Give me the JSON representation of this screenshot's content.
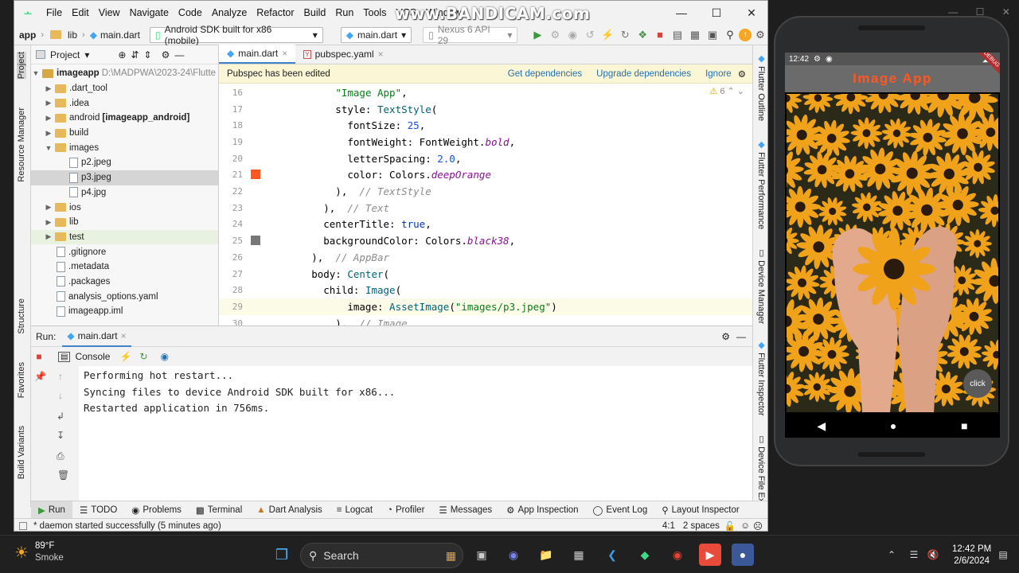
{
  "watermark": "www.BANDICAM.com",
  "menu": [
    "File",
    "Edit",
    "View",
    "Navigate",
    "Code",
    "Analyze",
    "Refactor",
    "Build",
    "Run",
    "Tools",
    "VCS",
    "Window"
  ],
  "nav": {
    "crumbs": [
      "app",
      "lib",
      "main.dart"
    ],
    "device_combo": "Android SDK built for x86 (mobile)",
    "file_combo": "main.dart",
    "emulator_combo": "Nexus 6 API 29"
  },
  "left_strip": [
    "Project",
    "Resource Manager",
    "Structure",
    "Favorites",
    "Build Variants"
  ],
  "right_strip": [
    "Flutter Outline",
    "Flutter Performance",
    "Device Manager",
    "Flutter Inspector",
    "Device File Ex"
  ],
  "project": {
    "header": "Project",
    "root_name": "imageapp",
    "root_path": "D:\\MADPWA\\2023-24\\Flutte",
    "items": [
      {
        "label": ".dart_tool",
        "type": "folder",
        "indent": 1
      },
      {
        "label": ".idea",
        "type": "folder",
        "indent": 1
      },
      {
        "label": "android",
        "bold_suffix": "[imageapp_android]",
        "type": "folder",
        "indent": 1
      },
      {
        "label": "build",
        "type": "folder",
        "indent": 1
      },
      {
        "label": "images",
        "type": "folder",
        "indent": 1,
        "open": true
      },
      {
        "label": "p2.jpeg",
        "type": "file",
        "indent": 2
      },
      {
        "label": "p3.jpeg",
        "type": "file",
        "indent": 2,
        "selected": true
      },
      {
        "label": "p4.jpg",
        "type": "file",
        "indent": 2
      },
      {
        "label": "ios",
        "type": "folder",
        "indent": 1
      },
      {
        "label": "lib",
        "type": "folder",
        "indent": 1
      },
      {
        "label": "test",
        "type": "folder",
        "indent": 1,
        "tint": true
      },
      {
        "label": ".gitignore",
        "type": "file",
        "indent": 1
      },
      {
        "label": ".metadata",
        "type": "file",
        "indent": 1
      },
      {
        "label": ".packages",
        "type": "file",
        "indent": 1
      },
      {
        "label": "analysis_options.yaml",
        "type": "file",
        "indent": 1
      },
      {
        "label": "imageapp.iml",
        "type": "file",
        "indent": 1
      }
    ]
  },
  "editor": {
    "tabs": [
      "main.dart",
      "pubspec.yaml"
    ],
    "notice": "Pubspec has been edited",
    "notice_actions": [
      "Get dependencies",
      "Upgrade dependencies",
      "Ignore"
    ],
    "warnings": "6",
    "lines": [
      16,
      17,
      18,
      19,
      20,
      21,
      22,
      23,
      24,
      25,
      26,
      27,
      28,
      29,
      30
    ]
  },
  "run": {
    "title": "Run:",
    "tab": "main.dart",
    "console_label": "Console",
    "output": [
      "Performing hot restart...",
      "Syncing files to device Android SDK built for x86...",
      "Restarted application in 756ms."
    ]
  },
  "bottom_tools": [
    "Run",
    "TODO",
    "Problems",
    "Terminal",
    "Dart Analysis",
    "Logcat",
    "Profiler",
    "Messages",
    "App Inspection",
    "Event Log",
    "Layout Inspector"
  ],
  "status": {
    "message": "* daemon started successfully (5 minutes ago)",
    "position": "4:1",
    "indent": "2 spaces"
  },
  "phone": {
    "time": "12:42",
    "app_title": "Image App",
    "fab_label": "click",
    "debug": "DEBUG"
  },
  "taskbar": {
    "temp": "89°F",
    "weather": "Smoke",
    "search": "Search",
    "time": "12:42 PM",
    "date": "2/6/2024"
  }
}
